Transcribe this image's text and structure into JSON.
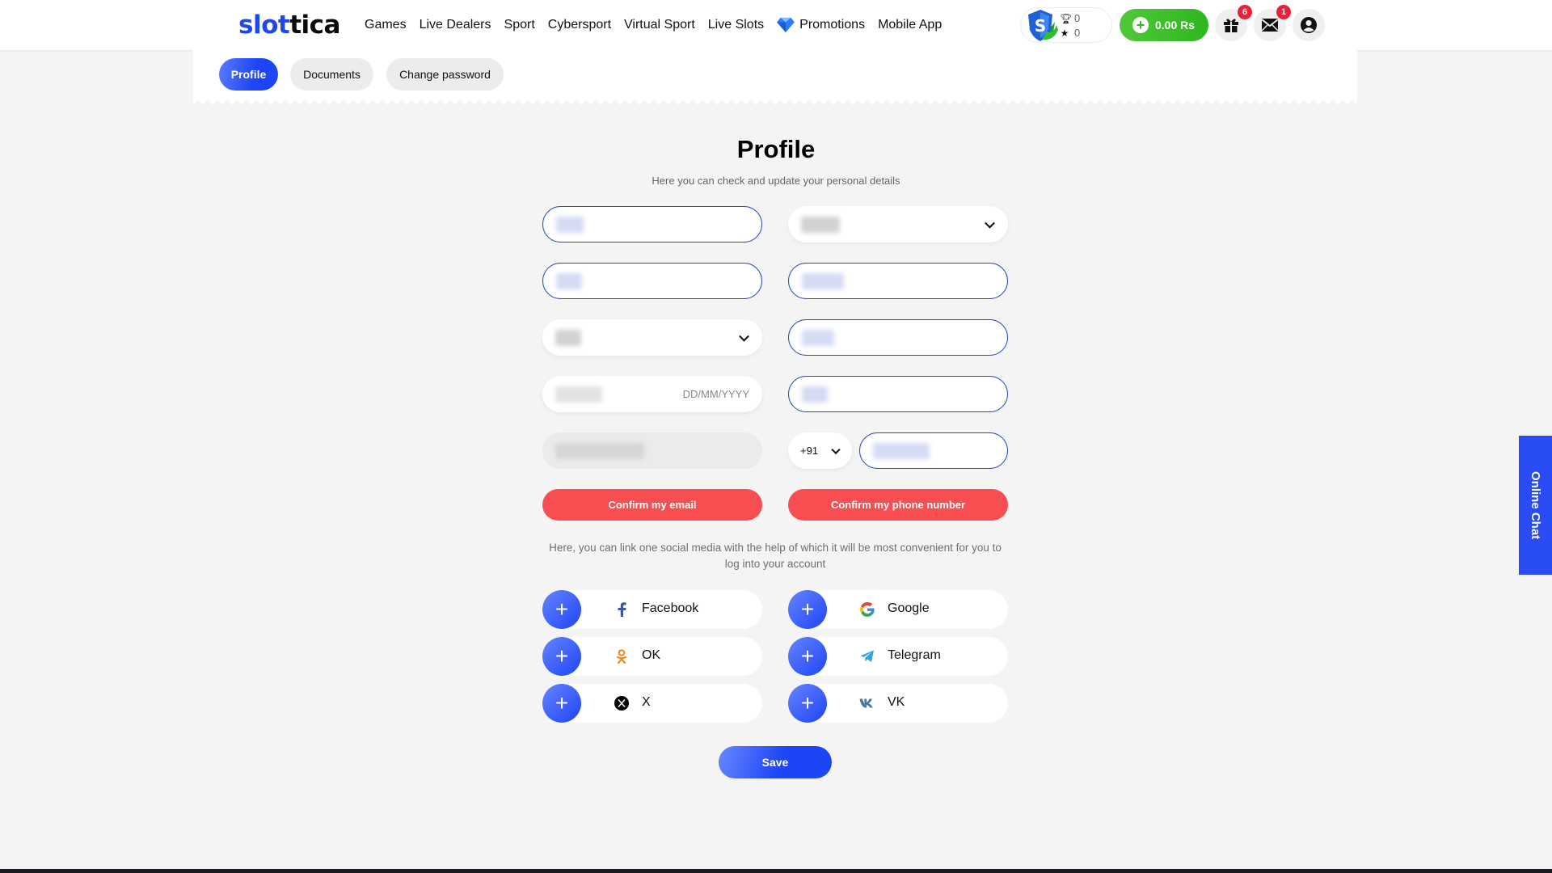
{
  "header": {
    "logo": {
      "part1": "slot",
      "part2": "tica"
    },
    "nav": [
      {
        "label": "Games"
      },
      {
        "label": "Live Dealers"
      },
      {
        "label": "Sport"
      },
      {
        "label": "Cybersport"
      },
      {
        "label": "Virtual Sport"
      },
      {
        "label": "Live Slots"
      },
      {
        "label": "Promotions",
        "icon": "diamond-icon"
      },
      {
        "label": "Mobile App"
      }
    ],
    "rank": {
      "trophies": "0",
      "stars": "0"
    },
    "balance": "0.00 Rs",
    "gifts_badge": "6",
    "messages_badge": "1"
  },
  "tabs": [
    {
      "label": "Profile",
      "active": true
    },
    {
      "label": "Documents",
      "active": false
    },
    {
      "label": "Change password",
      "active": false
    }
  ],
  "main": {
    "title": "Profile",
    "subtitle": "Here you can check and update your personal details",
    "date_placeholder": "DD/MM/YYYY",
    "phone_code": "+91",
    "confirm_email": "Confirm my email",
    "confirm_phone": "Confirm my phone number",
    "social_helper": "Here, you can link one social media with the help of which it will be most convenient for you to log into your account",
    "socials": [
      {
        "label": "Facebook",
        "icon": "facebook-icon"
      },
      {
        "label": "Google",
        "icon": "google-icon"
      },
      {
        "label": "OK",
        "icon": "odnoklassniki-icon"
      },
      {
        "label": "Telegram",
        "icon": "telegram-icon"
      },
      {
        "label": "X",
        "icon": "x-icon"
      },
      {
        "label": "VK",
        "icon": "vk-icon"
      }
    ],
    "save": "Save"
  },
  "online_chat": "Online Chat",
  "colors": {
    "brand_blue": "#1f47f0",
    "confirm_red": "#f84e52",
    "balance_green": "#33b823",
    "badge_red": "#e8203a"
  }
}
